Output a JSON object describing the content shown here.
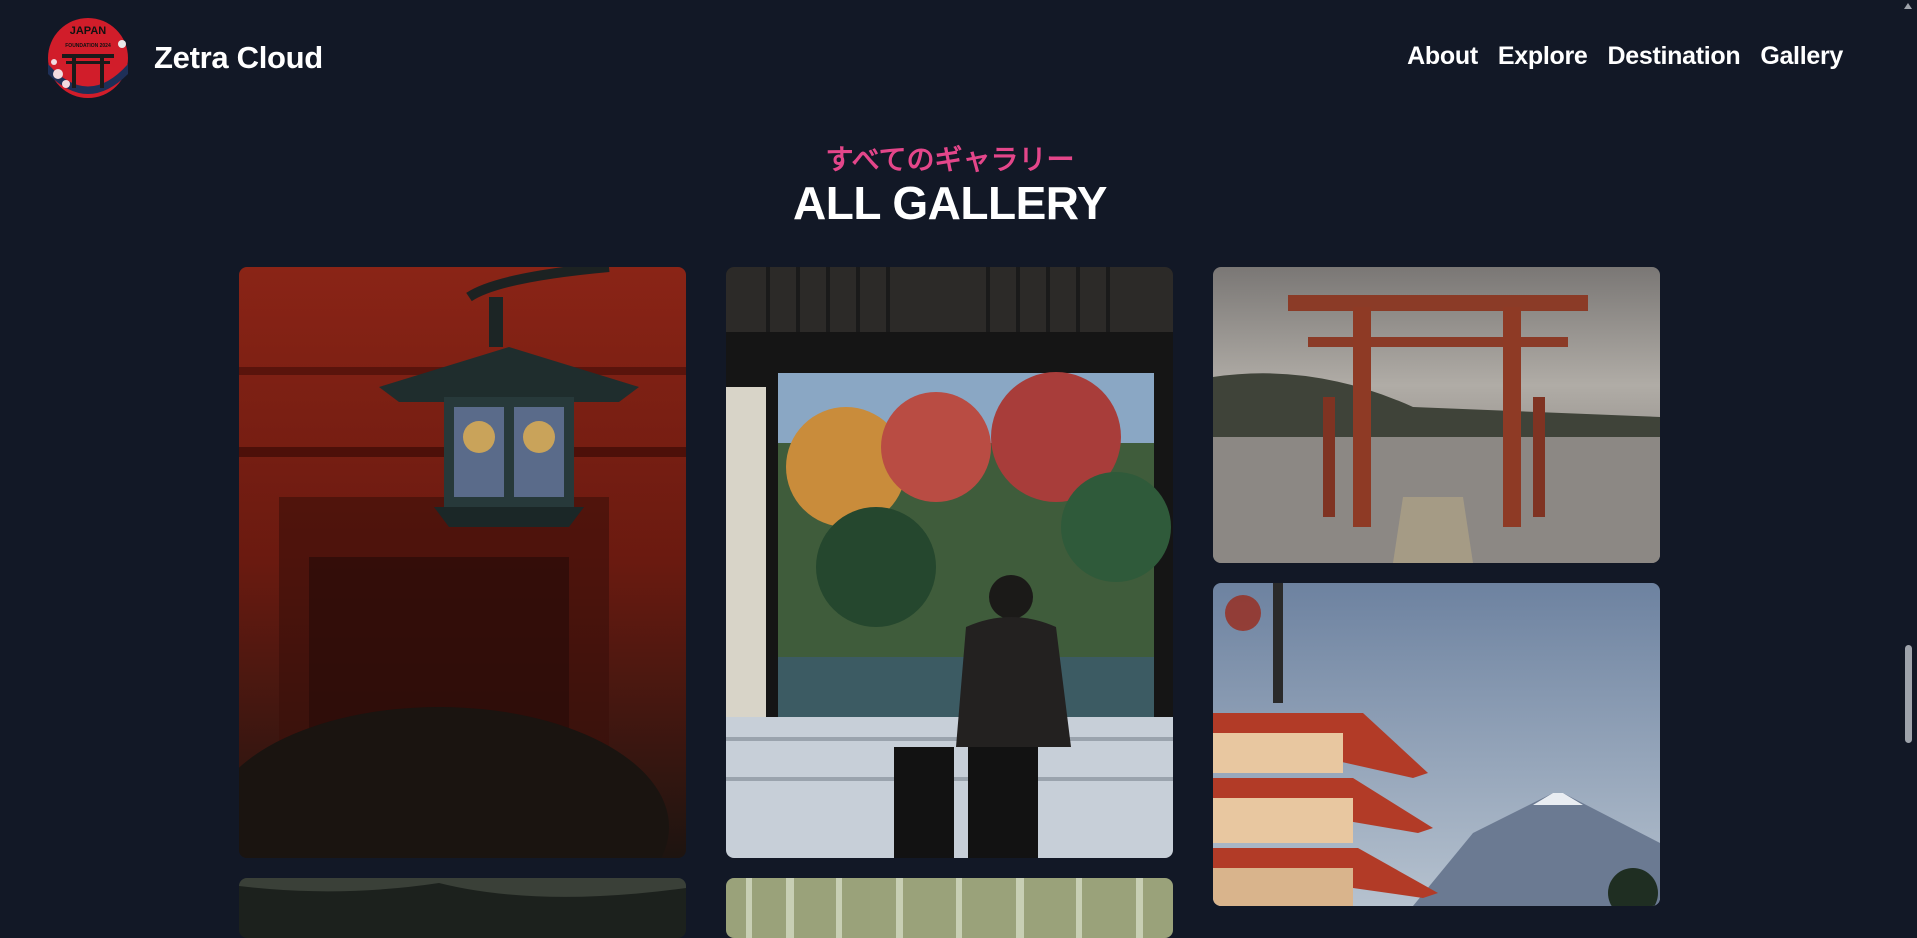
{
  "header": {
    "logo_text_line1": "JAPAN",
    "logo_text_line2": "FOUNDATION 2024",
    "brand": "Zetra Cloud",
    "nav": [
      "About",
      "Explore",
      "Destination",
      "Gallery"
    ]
  },
  "gallery": {
    "subtitle": "すべてのギャラリー",
    "title": "ALL GALLERY",
    "images": [
      {
        "name": "red-lantern-torii-photo",
        "subject": "lantern in torii tunnel"
      },
      {
        "name": "temple-garden-view-photo",
        "subject": "person viewing autumn garden"
      },
      {
        "name": "lake-torii-gate-photo",
        "subject": "torii gate in lake"
      },
      {
        "name": "pagoda-mount-fuji-photo",
        "subject": "pagoda with Mount Fuji"
      },
      {
        "name": "dark-foliage-photo",
        "subject": "partial image"
      },
      {
        "name": "bamboo-forest-photo",
        "subject": "partial image"
      }
    ]
  },
  "colors": {
    "background": "#121826",
    "accent": "#e4468a",
    "text": "#ffffff"
  }
}
